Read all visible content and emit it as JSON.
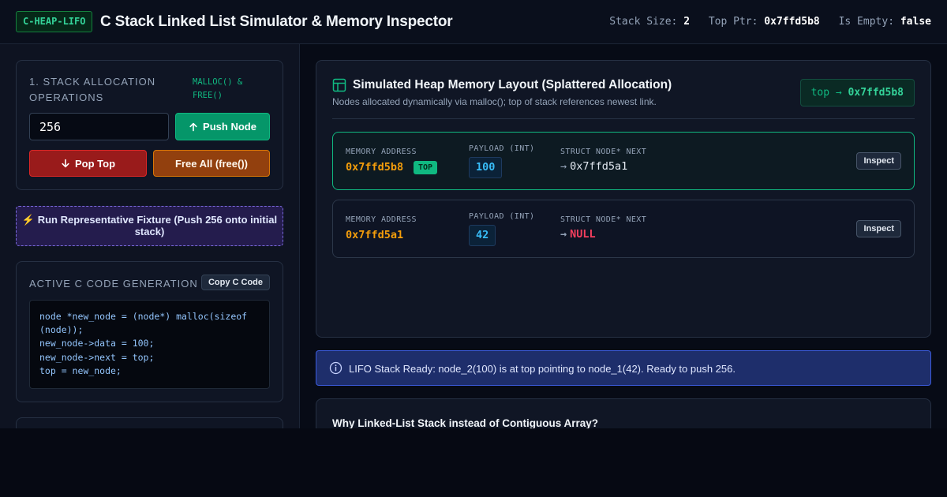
{
  "header": {
    "logo": "C-HEAP-LIFO",
    "title": "C Stack Linked List Simulator & Memory Inspector",
    "stats": [
      {
        "label": "Stack Size:",
        "value": "2"
      },
      {
        "label": "Top Ptr:",
        "value": "0x7ffd5b8"
      },
      {
        "label": "Is Empty:",
        "value": "false"
      }
    ]
  },
  "ops": {
    "title": "1. STACK ALLOCATION OPERATIONS",
    "tag": "MALLOC() & FREE()",
    "input_value": "256",
    "push_label": "Push Node",
    "pop_label": "Pop Top",
    "free_label": "Free All (free())"
  },
  "fixture": {
    "label": "⚡ Run Representative Fixture (Push 256 onto initial stack)"
  },
  "code": {
    "title": "ACTIVE C CODE GENERATION",
    "copy_label": "Copy C Code",
    "lines": [
      "node *new_node = (node*) malloc(sizeof (node));",
      "new_node->data = 100;",
      "new_node->next = top;",
      "top = new_node;"
    ]
  },
  "heap": {
    "title": "Simulated Heap Memory Layout (Splattered Allocation)",
    "subtitle": "Nodes allocated dynamically via malloc(); top of stack references newest link.",
    "top_pointer_label": "top →",
    "top_pointer_value": "0x7ffd5b8",
    "labels": {
      "address": "MEMORY ADDRESS",
      "payload": "PAYLOAD (INT)",
      "next": "STRUCT NODE* NEXT",
      "inspect": "Inspect",
      "top_badge": "TOP",
      "arrow": "→"
    },
    "nodes": [
      {
        "address": "0x7ffd5b8",
        "payload": "100",
        "next": "0x7ffd5a1"
      },
      {
        "address": "0x7ffd5a1",
        "payload": "42",
        "next": "NULL"
      }
    ]
  },
  "status": {
    "text": "LIFO Stack Ready: node_2(100) is at top pointing to node_1(42). Ready to push 256."
  },
  "why": {
    "title": "Why Linked-List Stack instead of Contiguous Array?"
  },
  "colors": {
    "accent": "#10b981",
    "address": "#f59e0b",
    "payload": "#38bdf8",
    "null": "#f43f5e",
    "info_bg": "#1e2e6b"
  }
}
